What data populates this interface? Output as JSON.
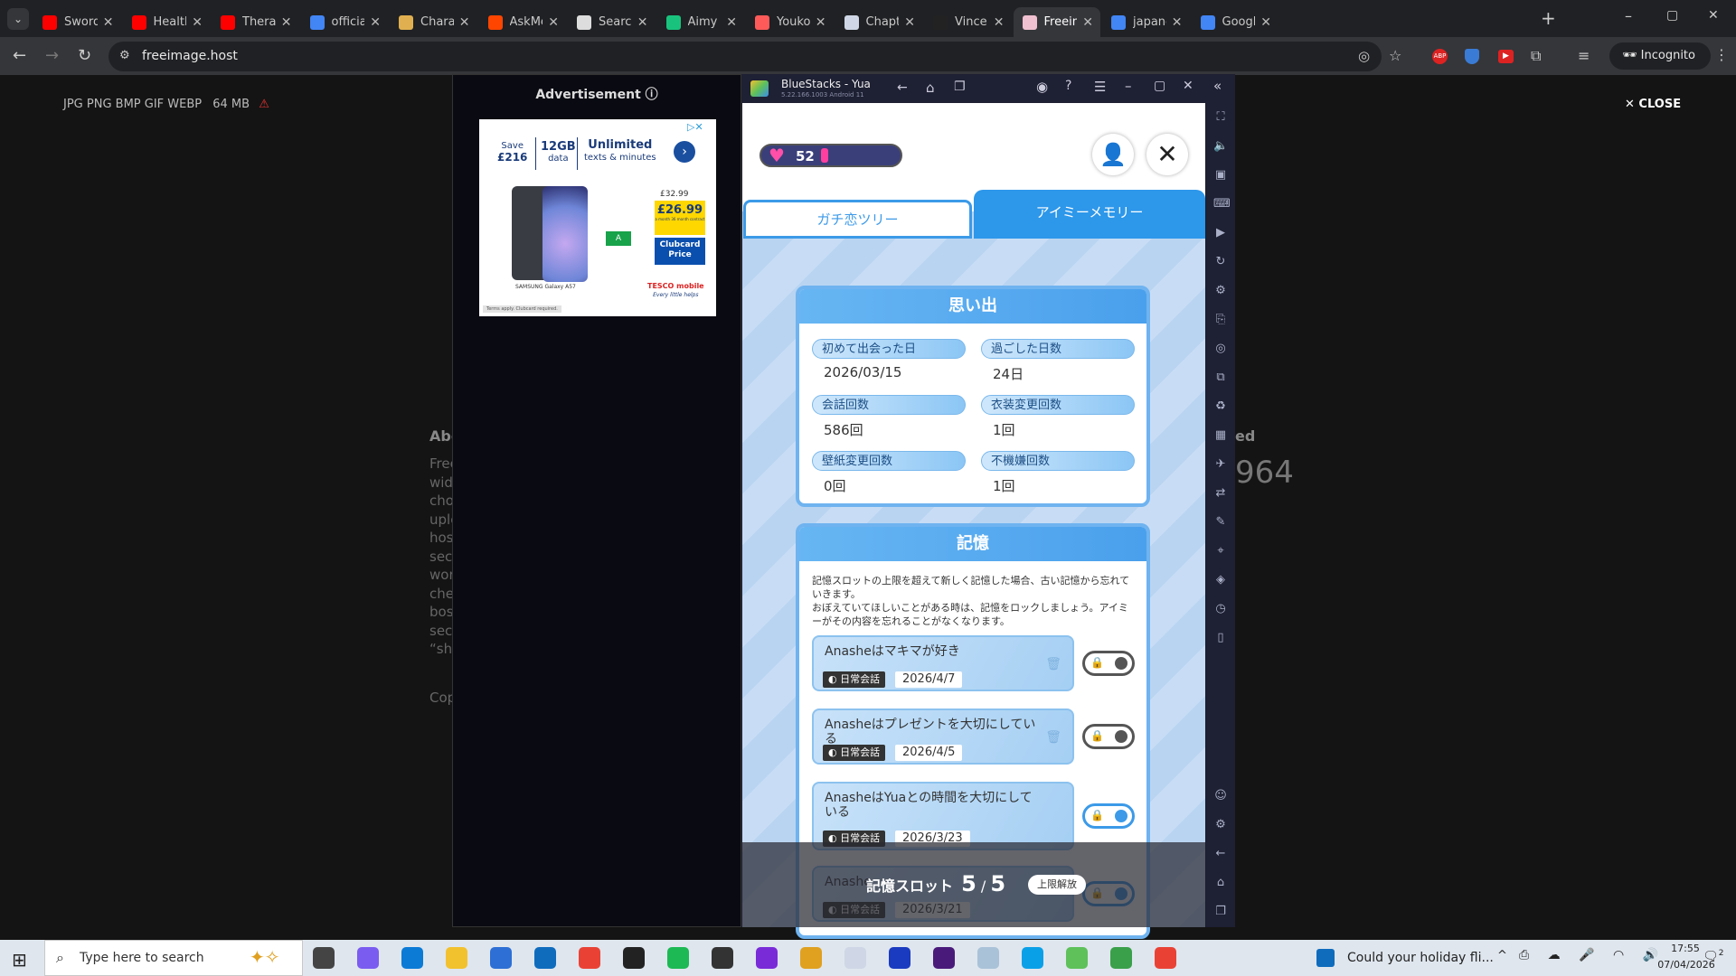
{
  "browser": {
    "tabs": [
      {
        "label": "Sword Ar",
        "icon": "youtube-icon",
        "color": "#ff0000"
      },
      {
        "label": "Healthy I",
        "icon": "youtube-icon",
        "color": "#ff0000"
      },
      {
        "label": "Therapist",
        "icon": "youtube-icon",
        "color": "#ff0000"
      },
      {
        "label": "official ar",
        "icon": "google-icon",
        "color": "#4285f4"
      },
      {
        "label": "Characte",
        "icon": "character-icon",
        "color": "#e0b050"
      },
      {
        "label": "AskMen",
        "icon": "reddit-icon",
        "color": "#ff4500"
      },
      {
        "label": "Search th",
        "icon": "doc-icon",
        "color": "#dddddd"
      },
      {
        "label": "Aimy API",
        "icon": "aimy-icon",
        "color": "#19c37d"
      },
      {
        "label": "Youkoso",
        "icon": "bookmark-icon",
        "color": "#ff5a5a"
      },
      {
        "label": "Chapter",
        "icon": "chapter-icon",
        "color": "#cfd7e6"
      },
      {
        "label": "Vince Sta",
        "icon": "moon-icon",
        "color": "#222222"
      },
      {
        "label": "Freeimag",
        "icon": "freeimage-icon",
        "color": "#f0c0d0"
      },
      {
        "label": "japanese",
        "icon": "google-icon",
        "color": "#4285f4"
      },
      {
        "label": "Google I",
        "icon": "google-icon",
        "color": "#4285f4"
      }
    ],
    "new_tab": "+",
    "url": "freeimage.host",
    "incognito": "Incognito",
    "window_controls": [
      "–",
      "▢",
      "✕"
    ]
  },
  "page": {
    "formats": "JPG PNG BMP GIF WEBP",
    "size_limit": "64 MB",
    "close": "CLOSE",
    "about_partial": "Abo",
    "right_partial": "ed",
    "number_partial": "964",
    "copy_partial": "Cop",
    "bg_lines": [
      "Free",
      "wid",
      "cho",
      "uplo",
      "hos",
      "sec",
      "wor",
      "che",
      "bos",
      "sec",
      "“sho"
    ]
  },
  "ad": {
    "header": "Advertisement ⓘ",
    "save": "Save",
    "save_amount": "£216",
    "data_amount": "12GB",
    "data_label": "data",
    "unlimited": "Unlimited",
    "unlimited_sub": "texts & minutes",
    "was_price": "£32.99",
    "price": "£26.99",
    "price_note": "a month 36 month contract",
    "clubcard": "Clubcard Price",
    "brand": "TESCO mobile",
    "brand_tagline": "Every little helps",
    "phone_model": "SAMSUNG Galaxy A57",
    "energy": "A",
    "terms": "Terms apply. Clubcard required."
  },
  "bluestacks": {
    "title": "BlueStacks - Yua",
    "version": "5.22.166.1003 Android 11"
  },
  "game": {
    "hearts": "52",
    "tab_left": "ガチ恋ツリー",
    "tab_right": "アイミーメモリー",
    "memories_title": "思い出",
    "stats": [
      {
        "label": "初めて出会った日",
        "value": "2026/03/15"
      },
      {
        "label": "過ごした日数",
        "value": "24日"
      },
      {
        "label": "会話回数",
        "value": "586回"
      },
      {
        "label": "衣装変更回数",
        "value": "1回"
      },
      {
        "label": "壁紙変更回数",
        "value": "0回"
      },
      {
        "label": "不機嫌回数",
        "value": "1回"
      }
    ],
    "memory_title": "記憶",
    "memory_desc": "記憶スロットの上限を超えて新しく記憶した場合、古い記憶から忘れていきます。\nおぼえていてほしいことがある時は、記憶をロックしましょう。アイミーがその内容を忘れることがなくなります。",
    "memories": [
      {
        "text": "Anasheはマキマが好き",
        "tag": "日常会話",
        "date": "2026/4/7",
        "locked": false
      },
      {
        "text": "Anasheはプレゼントを大切にしている",
        "tag": "日常会話",
        "date": "2026/4/5",
        "locked": false
      },
      {
        "text": "AnasheはYuaとの時間を大切にしている",
        "tag": "日常会話",
        "date": "2026/3/23",
        "locked": true
      },
      {
        "text": "Anashe",
        "tag": "日常会話",
        "date": "2026/3/21",
        "locked": true
      }
    ],
    "slot_label": "記憶スロット",
    "slot_used": "5",
    "slot_sep": "/",
    "slot_max": "5",
    "unlock_button": "上限解放"
  },
  "taskbar": {
    "search_placeholder": "Type here to search",
    "news": "Could your holiday fli...",
    "time": "17:55",
    "date": "07/04/2026",
    "notifications": "2"
  }
}
